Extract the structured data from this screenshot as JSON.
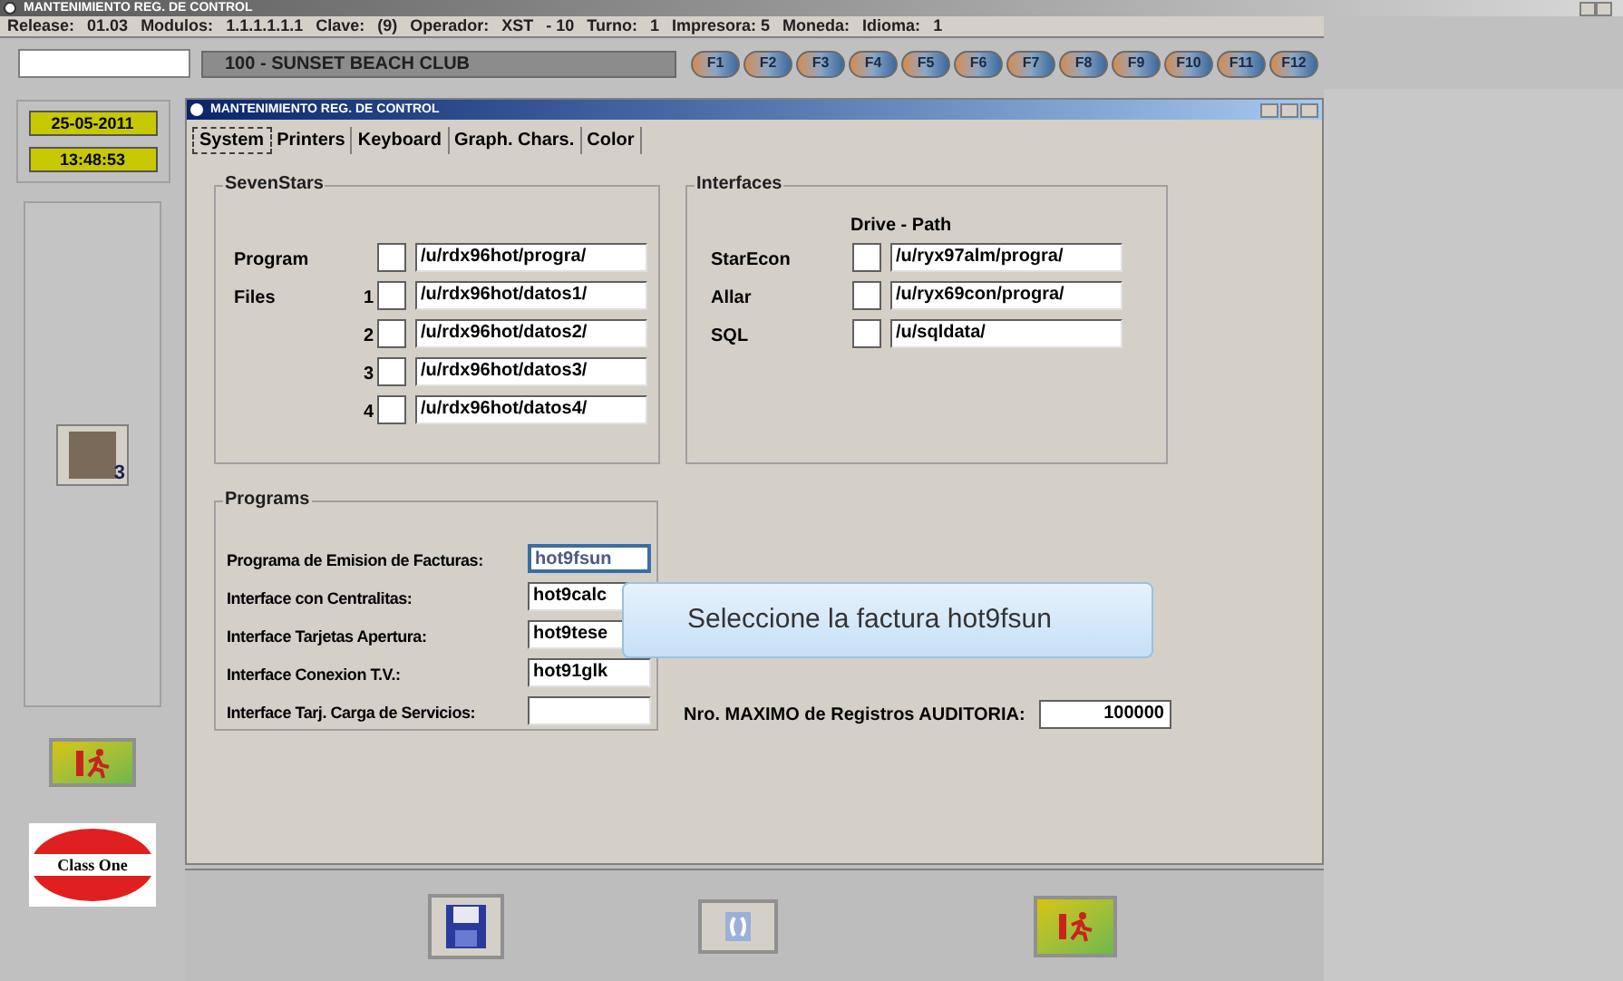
{
  "app_title": "MANTENIMIENTO REG. DE CONTROL",
  "info_bar": [
    "Release:",
    "01.03",
    "Modulos:",
    "1.1.1.1.1.1",
    "Clave:",
    "(9)",
    "Operador:",
    "XST",
    "- 10",
    "Turno:",
    "1",
    "Impresora: 5",
    "Moneda:",
    "Idioma:",
    "1"
  ],
  "hotel": "100 - SUNSET BEACH CLUB",
  "function_keys": [
    "F1",
    "F2",
    "F3",
    "F4",
    "F5",
    "F6",
    "F7",
    "F8",
    "F9",
    "F10",
    "F11",
    "F12"
  ],
  "date": "25-05-2011",
  "time": "13:48:53",
  "logo": "Class One",
  "user_badge": "3",
  "dialog": {
    "title": "MANTENIMIENTO REG. DE CONTROL",
    "tabs": [
      {
        "label": "System",
        "selected": true
      },
      {
        "label": "Printers",
        "selected": false
      },
      {
        "label": "Keyboard",
        "selected": false
      },
      {
        "label": "Graph. Chars.",
        "selected": false
      },
      {
        "label": "Color",
        "selected": false
      }
    ],
    "sevenstars": {
      "title": "SevenStars",
      "rows": [
        {
          "label": "Program",
          "number": "",
          "checked": false,
          "value": "/u/rdx96hot/progra/"
        },
        {
          "label": "Files",
          "number": "1",
          "checked": false,
          "value": "/u/rdx96hot/datos1/"
        },
        {
          "label": "",
          "number": "2",
          "checked": false,
          "value": "/u/rdx96hot/datos2/"
        },
        {
          "label": "",
          "number": "3",
          "checked": false,
          "value": "/u/rdx96hot/datos3/"
        },
        {
          "label": "",
          "number": "4",
          "checked": false,
          "value": "/u/rdx96hot/datos4/"
        }
      ]
    },
    "interfaces": {
      "title": "Interfaces",
      "header": "Drive - Path",
      "rows": [
        {
          "label": "StarEcon",
          "checked": false,
          "value": "/u/ryx97alm/progra/"
        },
        {
          "label": "Allar",
          "checked": false,
          "value": "/u/ryx69con/progra/"
        },
        {
          "label": "SQL",
          "checked": false,
          "value": "/u/sqldata/"
        }
      ]
    },
    "programs": {
      "title": "Programs",
      "rows": [
        {
          "label": "Programa de Emision de Facturas:",
          "value": "hot9fsun",
          "focused": true
        },
        {
          "label": "Interface con Centralitas:",
          "value": "hot9calc",
          "focused": false
        },
        {
          "label": "Interface Tarjetas Apertura:",
          "value": "hot9tese",
          "focused": false
        },
        {
          "label": "Interface Conexion T.V.:",
          "value": "hot91glk",
          "focused": false
        },
        {
          "label": "Interface Tarj. Carga de Servicios:",
          "value": "",
          "focused": false
        }
      ]
    },
    "audit": {
      "label": "Nro. MAXIMO de Registros AUDITORIA:",
      "value": "100000"
    }
  },
  "tooltip": "Seleccione la factura hot9fsun"
}
